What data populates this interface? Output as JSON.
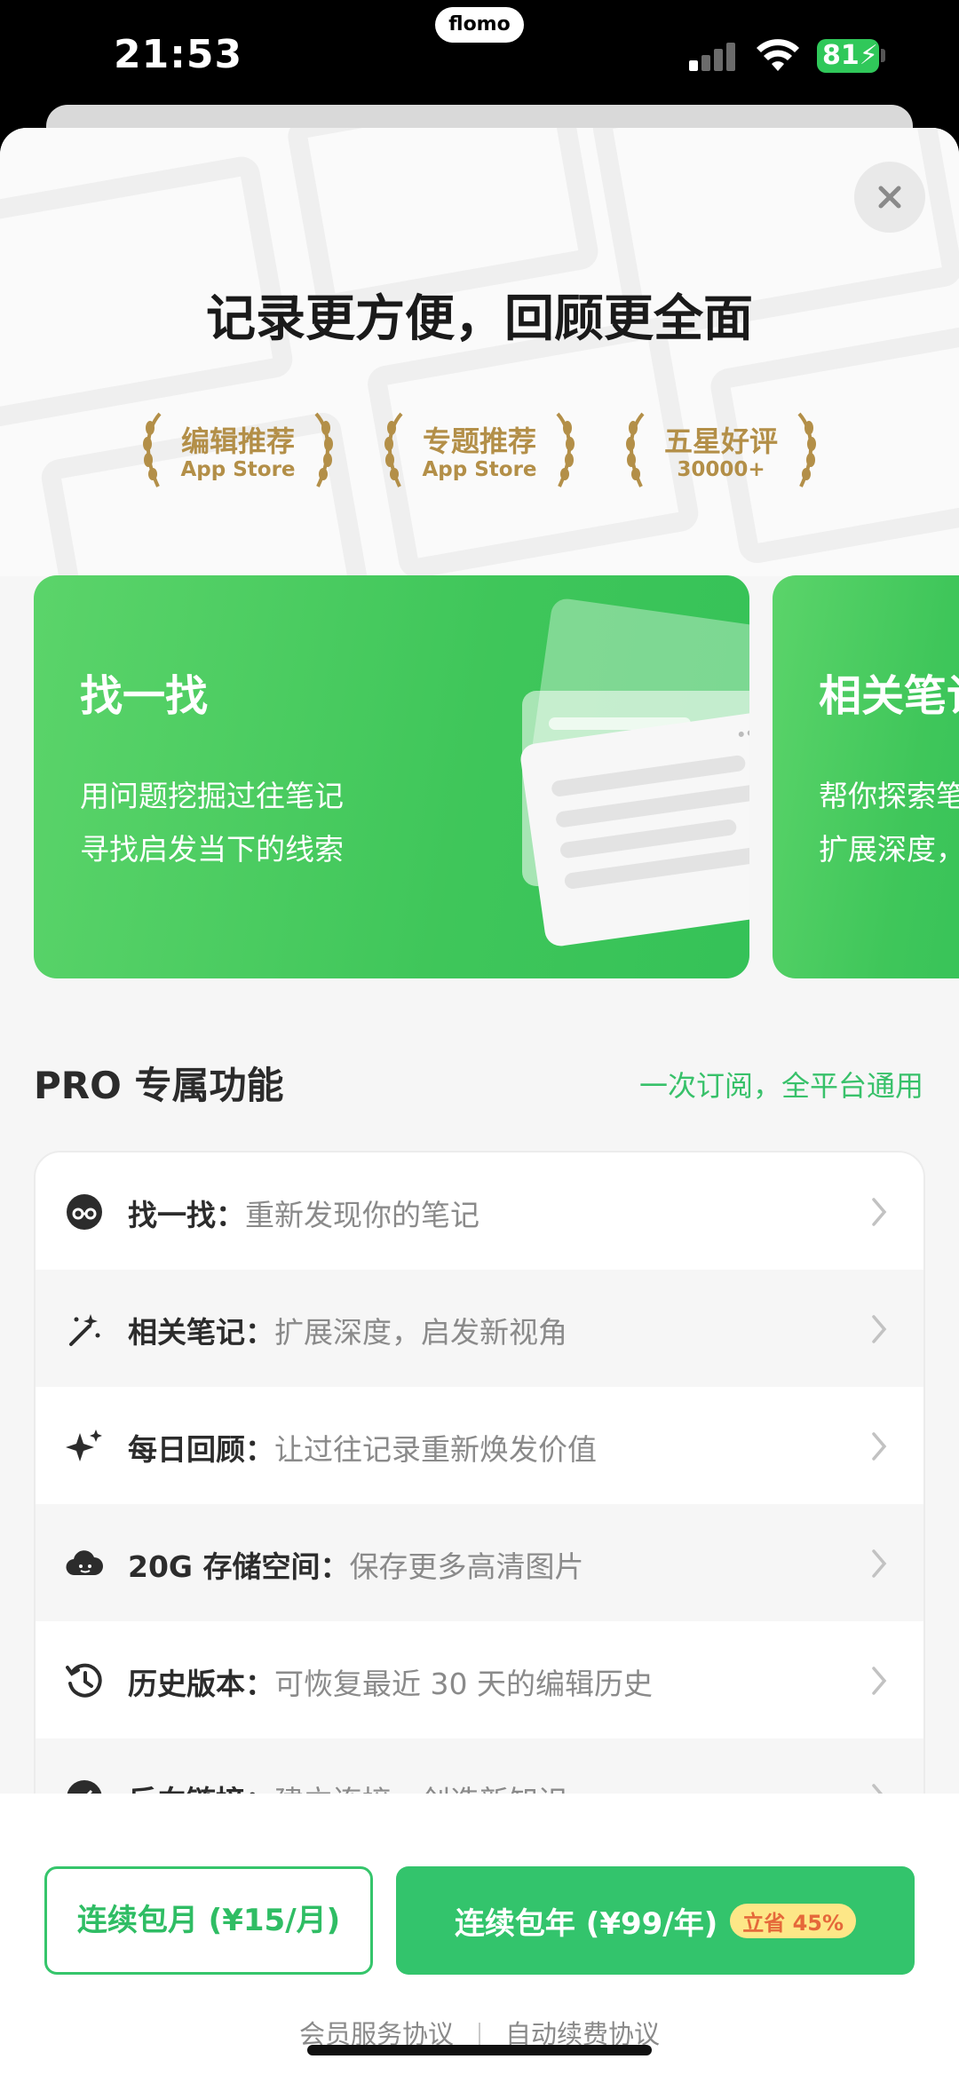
{
  "status_bar": {
    "time": "21:53",
    "island_label": "flomo",
    "battery": "81"
  },
  "hero": {
    "headline": "记录更方便，回顾更全面",
    "awards": [
      {
        "title": "编辑推荐",
        "subtitle": "App Store"
      },
      {
        "title": "专题推荐",
        "subtitle": "App Store"
      },
      {
        "title": "五星好评",
        "subtitle": "30000+"
      }
    ]
  },
  "feature_cards": [
    {
      "title": "找一找",
      "lines": [
        "用问题挖掘过往笔记",
        "寻找启发当下的线索"
      ]
    },
    {
      "title": "相关笔记",
      "lines": [
        "帮你探索笔记",
        "扩展深度，"
      ]
    }
  ],
  "pro_section": {
    "title_pro": "PRO",
    "title_rest": " 专属功能",
    "link": "一次订阅，全平台通用",
    "features": [
      {
        "icon": "incognito-icon",
        "name": "找一找：",
        "desc": "重新发现你的笔记"
      },
      {
        "icon": "magic-wand-icon",
        "name": "相关笔记：",
        "desc": "扩展深度，启发新视角"
      },
      {
        "icon": "sparkles-icon",
        "name": "每日回顾：",
        "desc": "让过往记录重新焕发价值"
      },
      {
        "icon": "cloud-icon",
        "name": "20G 存储空间：",
        "desc": "保存更多高清图片"
      },
      {
        "icon": "history-icon",
        "name": "历史版本：",
        "desc": "可恢复最近 30 天的编辑历史"
      },
      {
        "icon": "link-icon",
        "name": "反向链接：",
        "desc": "建立连接，创造新知识"
      }
    ]
  },
  "footer": {
    "monthly_button": "连续包月 (¥15/月)",
    "yearly_button": "连续包年 (¥99/年)",
    "save_badge": "立省 45%",
    "agreement_member": "会员服务协议",
    "agreement_renewal": "自动续费协议"
  },
  "colors": {
    "accent_green": "#33c46c",
    "gold": "#b38f48",
    "badge_yellow": "#fde787"
  }
}
